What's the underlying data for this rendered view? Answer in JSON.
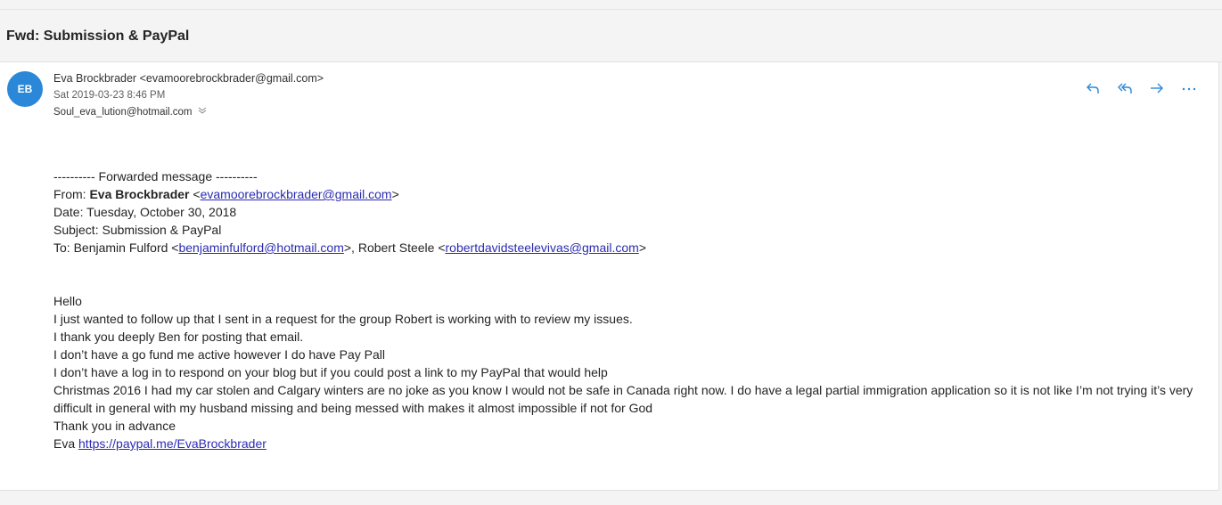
{
  "subject": "Fwd: Submission & PayPal",
  "sender": {
    "initials": "EB",
    "from_line": "Eva Brockbrader <evamoorebrockbrader@gmail.com>",
    "date": "Sat 2019-03-23 8:46 PM",
    "to": "Soul_eva_lution@hotmail.com"
  },
  "icons": {
    "reply": "reply-icon",
    "reply_all": "reply-all-icon",
    "forward": "forward-icon",
    "more": "more-icon",
    "expand": "chevron-down-icon"
  },
  "accent_color": "#2b88d8",
  "forwarded": {
    "separator": "---------- Forwarded message ----------",
    "from_label": "From: ",
    "from_name": "Eva Brockbrader",
    "from_email": "evamoorebrockbrader@gmail.com",
    "date_line": "Date: Tuesday, October 30, 2018",
    "subject_line": "Subject: Submission & PayPal",
    "to_label": "To: Benjamin Fulford <",
    "to_email1": "benjaminfulford@hotmail.com",
    "to_mid": ">, Robert Steele <",
    "to_email2": "robertdavidsteelevivas@gmail.com",
    "to_end": ">"
  },
  "message": {
    "lines": [
      "Hello",
      "I just wanted to follow up that I sent in a request for the group Robert is working with to review my issues.",
      "I thank you deeply Ben for posting that email.",
      "I don’t have a go fund me active however I do have Pay Pall",
      "I don’t have a log in to respond on your blog but if you could post a link to my PayPal that would help",
      "Christmas 2016 I had my car stolen and Calgary winters are no joke as you know I would not be safe in Canada right now. I do have a legal partial immigration application so it is not like I’m not trying it’s very difficult in general with my husband missing and being messed with makes it almost impossible if not for God",
      "Thank you in advance"
    ],
    "sign_name": "Eva ",
    "sign_link": "https://paypal.me/EvaBrockbrader"
  }
}
